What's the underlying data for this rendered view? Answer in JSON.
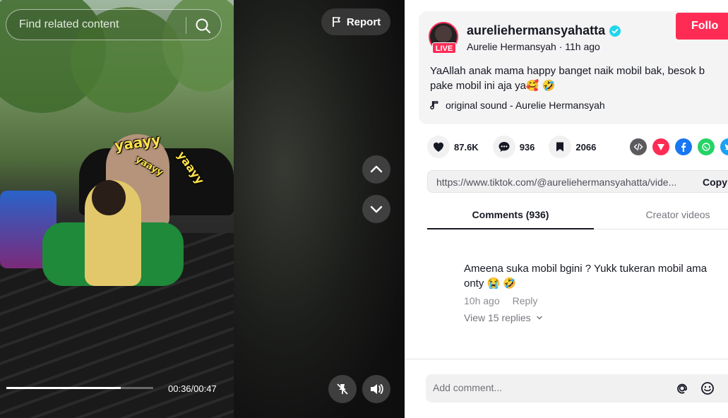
{
  "video": {
    "search_placeholder": "Find related content",
    "report_label": "Report",
    "stickers": [
      "yaayy",
      "yaayy",
      "yaayy"
    ],
    "current_time": "00:36",
    "duration": "00:47",
    "time_display": "00:36/00:47",
    "progress_fraction": 0.78
  },
  "author": {
    "username": "aureliehermansyahatta",
    "display_name": "Aurelie Hermansyah",
    "posted": "11h ago",
    "subline": "Aurelie Hermansyah · 11h ago",
    "live_badge": "LIVE",
    "verified": true
  },
  "follow_label": "Follo",
  "caption_line1": "YaAllah anak mama happy banget naik mobil bak, besok b",
  "caption_line2": "pake mobil ini aja ya🥰 🤣",
  "sound": "original sound - Aurelie Hermansyah",
  "stats": {
    "likes": "87.6K",
    "comments": "936",
    "saves": "2066"
  },
  "share_icons": [
    "embed-icon",
    "send-icon",
    "facebook-icon",
    "whatsapp-icon",
    "twitter-icon"
  ],
  "link": {
    "url": "https://www.tiktok.com/@aureliehermansyahatta/vide...",
    "copy_label": "Copy"
  },
  "tabs": {
    "comments": "Comments (936)",
    "creator": "Creator videos"
  },
  "comment": {
    "line1": "Ameena suka mobil bgini ? Yukk tukeran mobil ama",
    "line2": "onty 😭 🤣",
    "time": "10h ago",
    "reply_label": "Reply",
    "view_replies": "View 15 replies"
  },
  "add_comment_placeholder": "Add comment...",
  "colors": {
    "brand": "#fe2c55",
    "verified": "#20d5ec",
    "text": "#161823"
  }
}
